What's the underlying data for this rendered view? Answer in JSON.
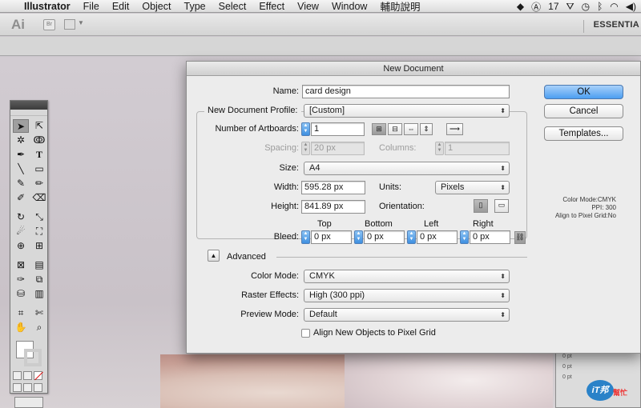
{
  "menubar": {
    "app_name": "Illustrator",
    "items": [
      "File",
      "Edit",
      "Object",
      "Type",
      "Select",
      "Effect",
      "View",
      "Window",
      "輔助說明"
    ],
    "tray_number": "17"
  },
  "appbar": {
    "logo": "Ai",
    "bridge": "Br",
    "workspace": "ESSENTIA"
  },
  "dialog": {
    "title": "New Document",
    "name_label": "Name:",
    "name_value": "card design",
    "profile_label": "New Document Profile:",
    "profile_value": "[Custom]",
    "artboards_label": "Number of Artboards:",
    "artboards_value": "1",
    "spacing_label": "Spacing:",
    "spacing_value": "20 px",
    "columns_label": "Columns:",
    "columns_value": "1",
    "size_label": "Size:",
    "size_value": "A4",
    "width_label": "Width:",
    "width_value": "595.28 px",
    "units_label": "Units:",
    "units_value": "Pixels",
    "height_label": "Height:",
    "height_value": "841.89 px",
    "orientation_label": "Orientation:",
    "bleed_label": "Bleed:",
    "bleed": {
      "top_label": "Top",
      "bottom_label": "Bottom",
      "left_label": "Left",
      "right_label": "Right",
      "top": "0 px",
      "bottom": "0 px",
      "left": "0 px",
      "right": "0 px"
    },
    "advanced_label": "Advanced",
    "color_mode_label": "Color Mode:",
    "color_mode_value": "CMYK",
    "raster_label": "Raster Effects:",
    "raster_value": "High (300 ppi)",
    "preview_label": "Preview Mode:",
    "preview_value": "Default",
    "align_label": "Align New Objects to Pixel Grid",
    "ok_label": "OK",
    "cancel_label": "Cancel",
    "templates_label": "Templates...",
    "info": {
      "color_mode": "Color Mode:CMYK",
      "ppi": "PPI: 300",
      "align": "Align to Pixel Grid:No"
    }
  },
  "right_panel": {
    "rows": [
      "0 pt",
      "0 pt",
      "0 pt"
    ],
    "watermark": "iT邦",
    "watermark_sub": "幫忙"
  }
}
